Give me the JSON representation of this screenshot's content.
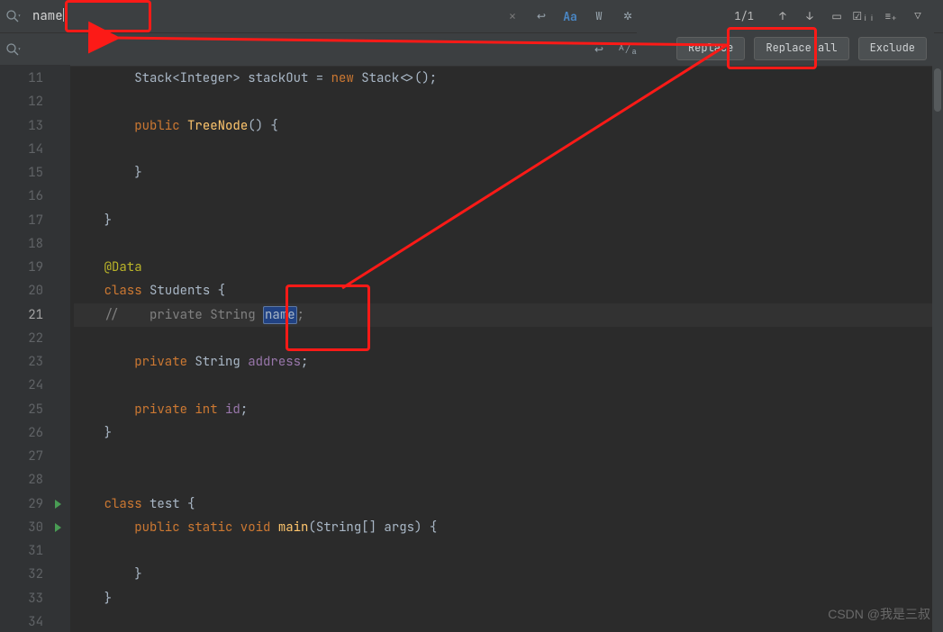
{
  "search": {
    "value": "name",
    "clear_icon": "×",
    "multiline_icon": "↩",
    "case_icon": "Aa",
    "word_icon": "W",
    "regex_icon": "✲"
  },
  "replace": {
    "value": "",
    "preserve_icon": "↩",
    "fa_icon": "ᴬ⁄ₐ"
  },
  "counter": "1/1",
  "nav": {
    "prev_icon": "↑",
    "next_icon": "↓",
    "sel_icon": "▭",
    "multi_icon": "☑ᵢᵢ",
    "add_sel_icon": "≡₊",
    "filter_icon": "▽"
  },
  "buttons": {
    "replace": "Replace",
    "replace_all": "Replace all",
    "exclude": "Exclude"
  },
  "lines": [
    "11",
    "12",
    "13",
    "14",
    "15",
    "16",
    "17",
    "18",
    "19",
    "20",
    "21",
    "22",
    "23",
    "24",
    "25",
    "26",
    "27",
    "28",
    "29",
    "30",
    "31",
    "32",
    "33",
    "34"
  ],
  "code": {
    "l11": {
      "pre": "        Stack<Integer> stackOut = ",
      "kw": "new",
      "post": " Stack<>();"
    },
    "l13": {
      "kw": "public",
      "sp": " ",
      "fn": "TreeNode",
      "post": "() {"
    },
    "l15": "        }",
    "l17": "    }",
    "l19": "@Data",
    "l20": {
      "kw": "class ",
      "nm": "Students",
      "post": " {"
    },
    "l21": {
      "cmt": "//    private String ",
      "hl": "name",
      "post": ";"
    },
    "l23": {
      "kw": "private ",
      "ty": "String ",
      "fld": "address",
      "post": ";"
    },
    "l25": {
      "kw": "private int ",
      "fld": "id",
      "post": ";"
    },
    "l26": "    }",
    "l29": {
      "kw": "class ",
      "nm": "test",
      "post": " {"
    },
    "l30": {
      "kw": "public static void ",
      "fn": "main",
      "post": "(String[] args) {"
    },
    "l32": "        }",
    "l33": "    }"
  },
  "watermark": "CSDN @我是三叔"
}
